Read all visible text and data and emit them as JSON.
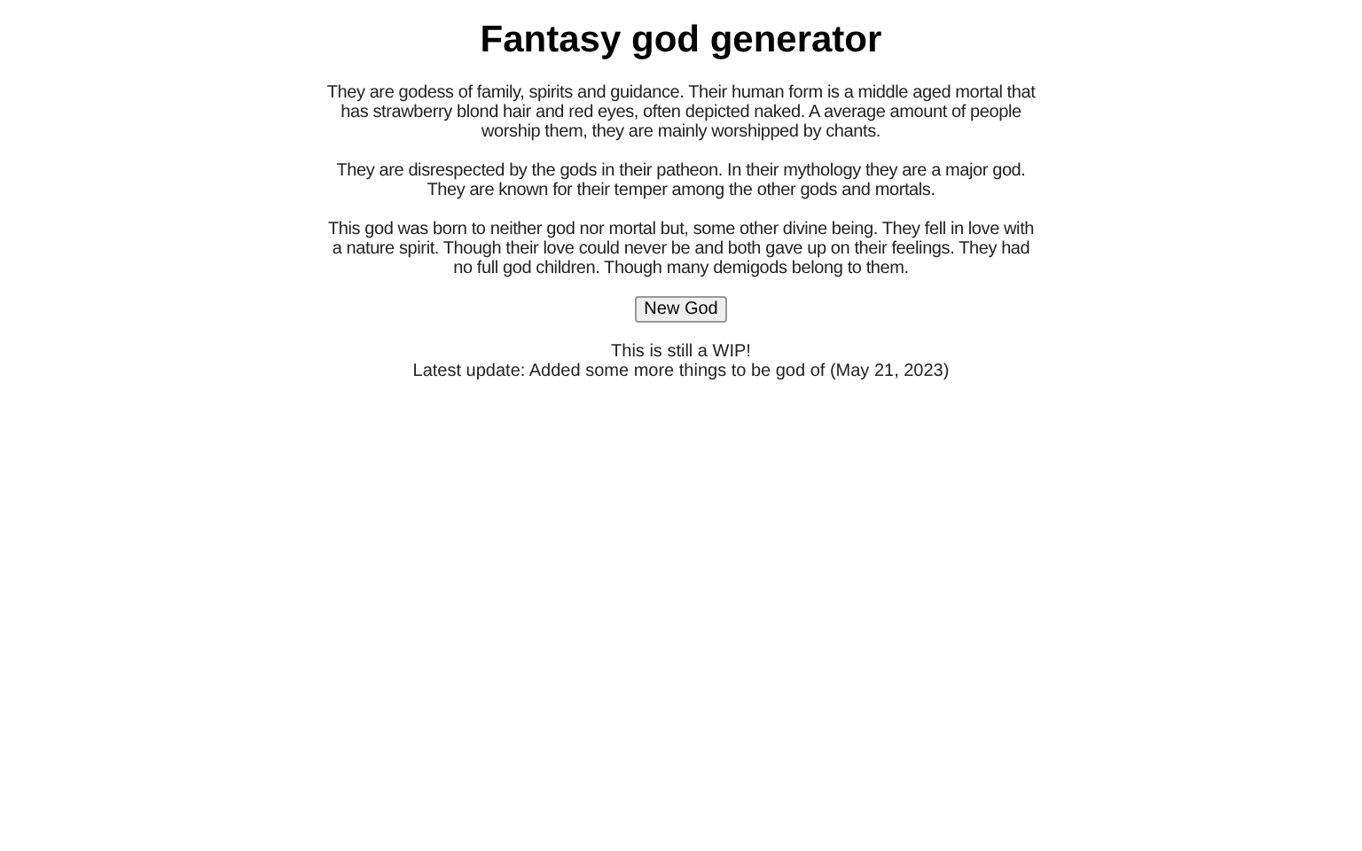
{
  "title": "Fantasy god generator",
  "paragraphs": [
    "They are godess of family, spirits and guidance. Their human form is a middle aged mortal that has strawberry blond hair and red eyes, often depicted naked. A average amount of people worship them, they are mainly worshipped by chants.",
    "They are disrespected by the gods in their patheon. In their mythology they are a major god. They are known for their temper among the other gods and mortals.",
    "This god was born to neither god nor mortal but, some other divine being. They fell in love with a nature spirit. Though their love could never be and both gave up on their feelings. They had no full god children. Though many demigods belong to them."
  ],
  "button": "New God",
  "footer": [
    "This is still a WIP!",
    "Latest update: Added some more things to be god of (May 21, 2023)"
  ]
}
